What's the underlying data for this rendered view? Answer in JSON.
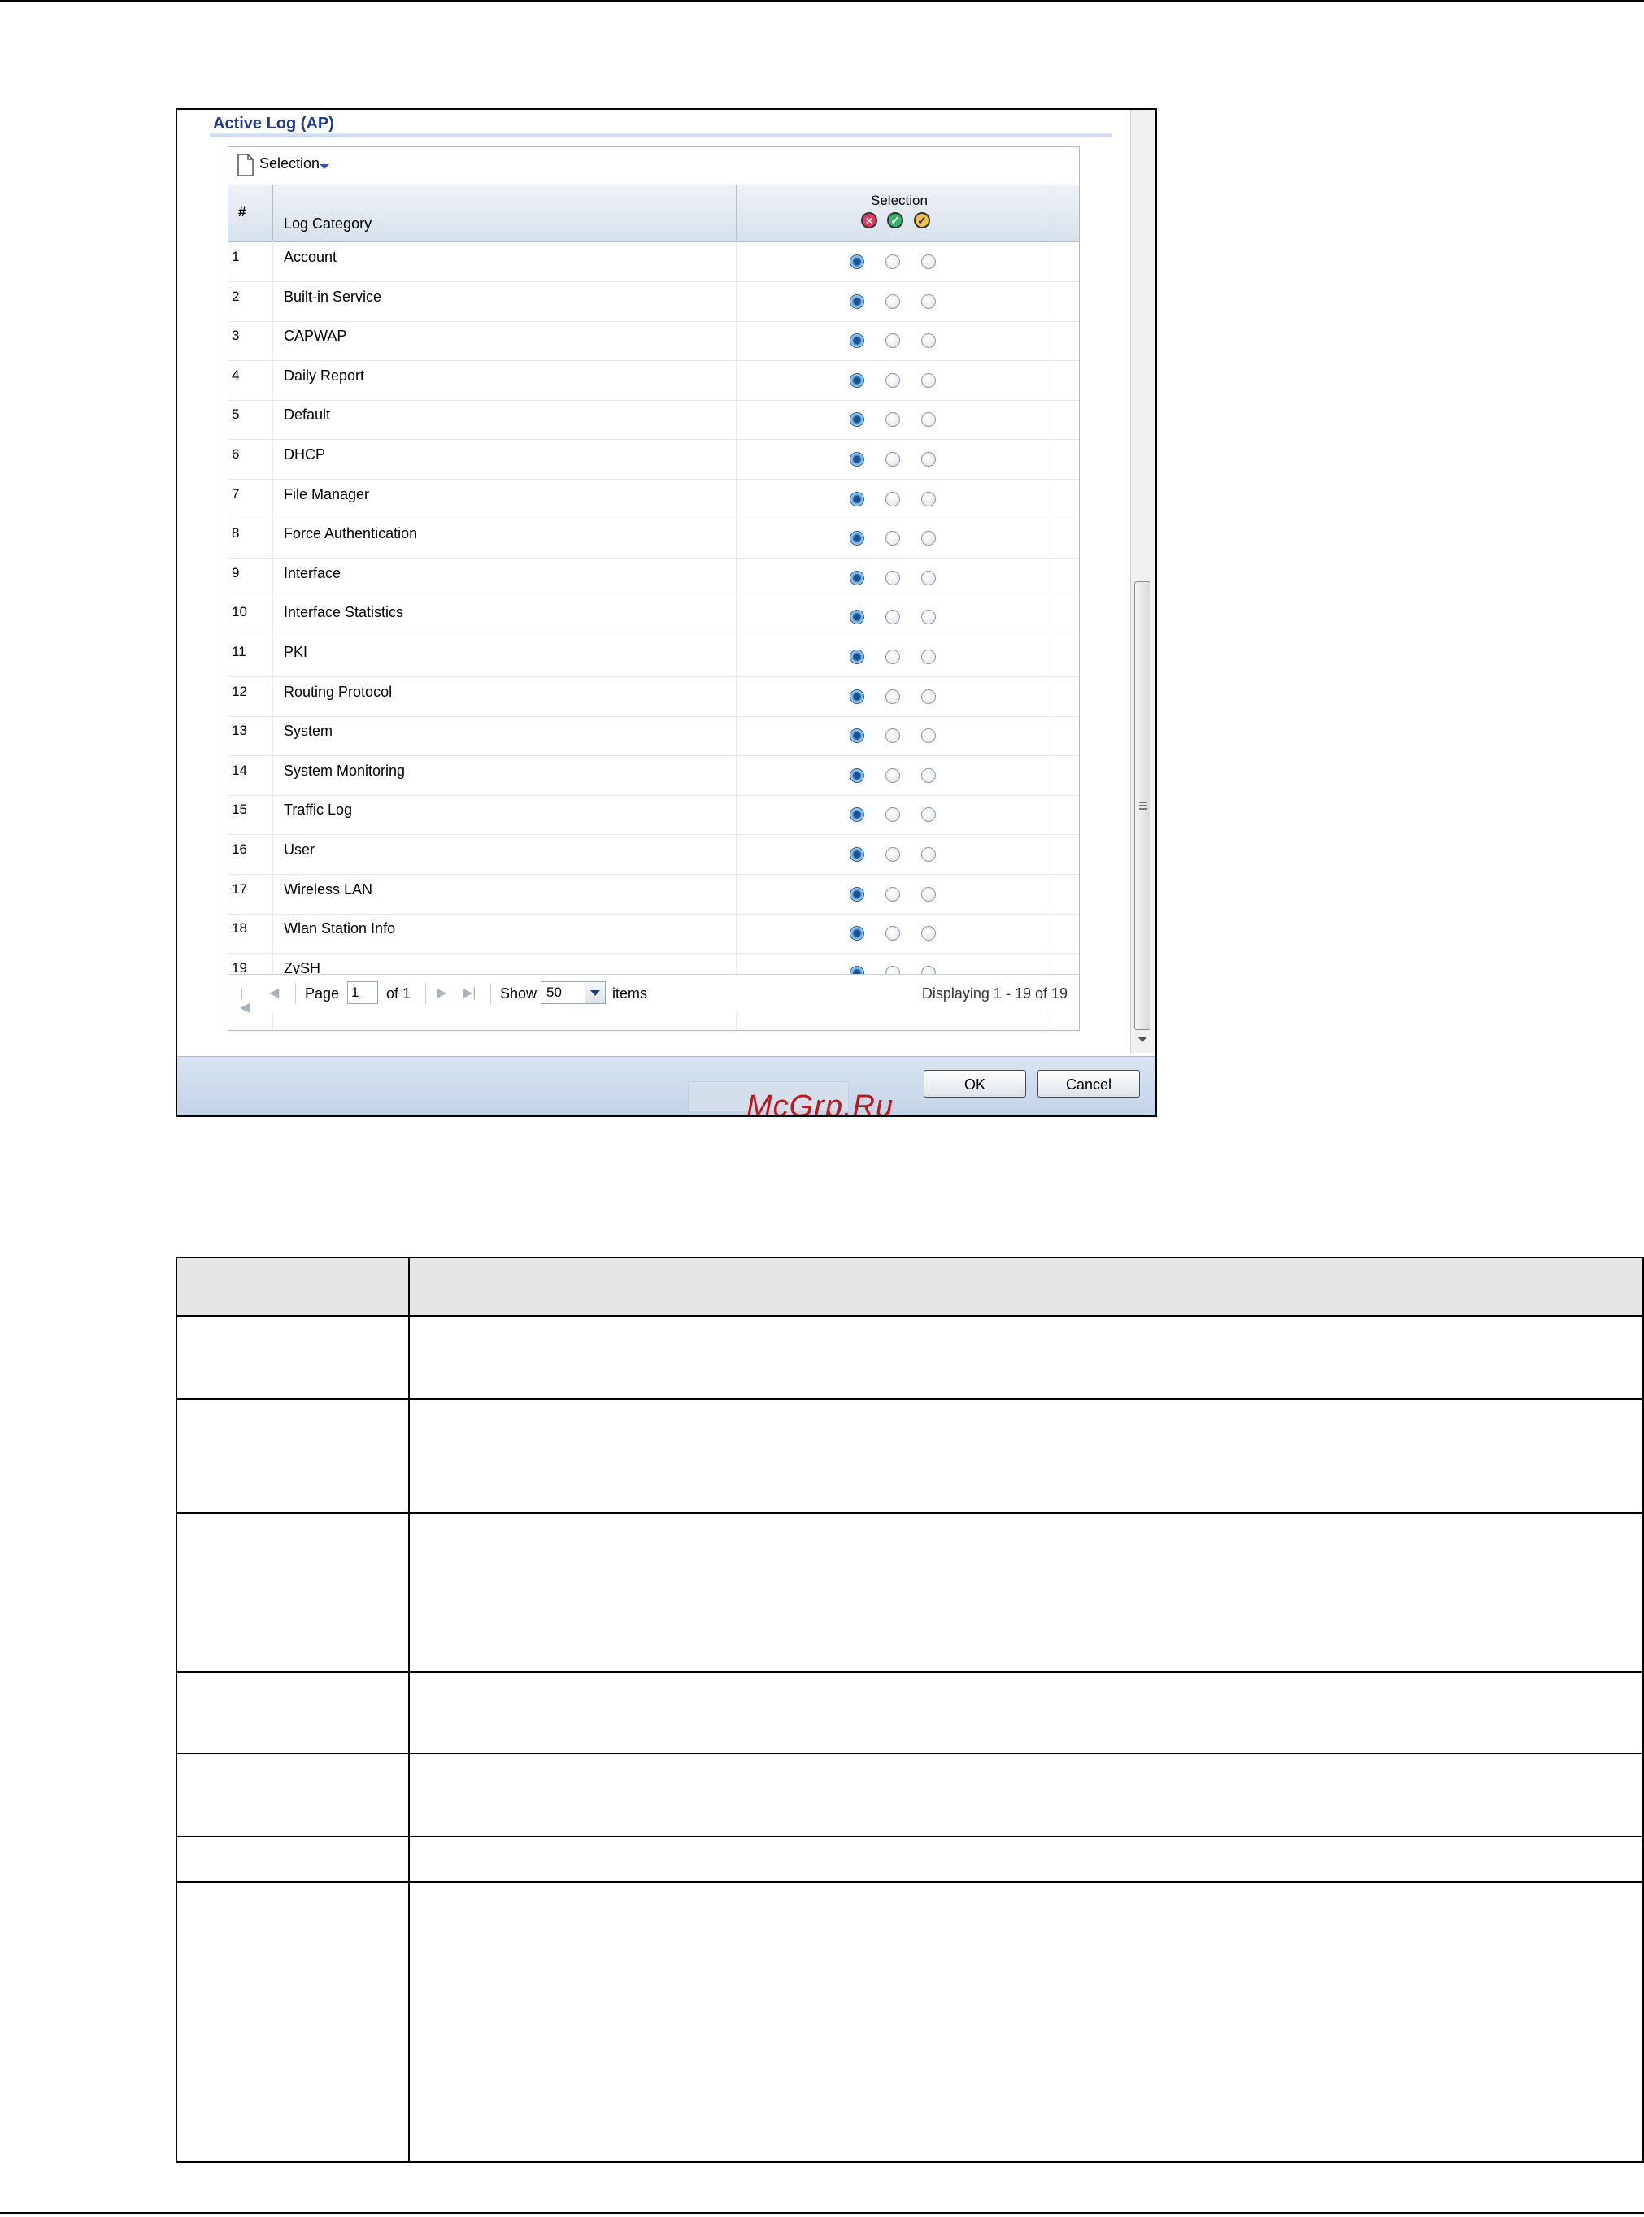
{
  "dialog": {
    "title": "Active Log (AP)",
    "toolbar": {
      "selection_menu": "Selection"
    },
    "grid": {
      "columns": {
        "number": "#",
        "category": "Log Category",
        "selection": "Selection"
      },
      "selection_icons": [
        "disable-icon",
        "normal-icon",
        "debug-icon"
      ],
      "rows": [
        {
          "num": "1",
          "category": "Account",
          "selected": 0
        },
        {
          "num": "2",
          "category": "Built-in Service",
          "selected": 0
        },
        {
          "num": "3",
          "category": "CAPWAP",
          "selected": 0
        },
        {
          "num": "4",
          "category": "Daily Report",
          "selected": 0
        },
        {
          "num": "5",
          "category": "Default",
          "selected": 0
        },
        {
          "num": "6",
          "category": "DHCP",
          "selected": 0
        },
        {
          "num": "7",
          "category": "File Manager",
          "selected": 0
        },
        {
          "num": "8",
          "category": "Force Authentication",
          "selected": 0
        },
        {
          "num": "9",
          "category": "Interface",
          "selected": 0
        },
        {
          "num": "10",
          "category": "Interface Statistics",
          "selected": 0
        },
        {
          "num": "11",
          "category": "PKI",
          "selected": 0
        },
        {
          "num": "12",
          "category": "Routing Protocol",
          "selected": 0
        },
        {
          "num": "13",
          "category": "System",
          "selected": 0
        },
        {
          "num": "14",
          "category": "System Monitoring",
          "selected": 0
        },
        {
          "num": "15",
          "category": "Traffic Log",
          "selected": 0
        },
        {
          "num": "16",
          "category": "User",
          "selected": 0
        },
        {
          "num": "17",
          "category": "Wireless LAN",
          "selected": 0
        },
        {
          "num": "18",
          "category": "Wlan Station Info",
          "selected": 0
        },
        {
          "num": "19",
          "category": "ZySH",
          "selected": 0
        }
      ]
    },
    "pager": {
      "page_label": "Page",
      "page_value": "1",
      "of_label": "of 1",
      "show_label": "Show",
      "show_value": "50",
      "items_label": "items",
      "displaying": "Displaying 1 - 19 of 19"
    },
    "buttons": {
      "ok": "OK",
      "cancel": "Cancel"
    },
    "watermark": "McGrp.Ru"
  },
  "colors": {
    "title_blue": "#1f3c8c",
    "footer_blue": "#c2d2e6",
    "watermark_red": "#c0171f"
  }
}
